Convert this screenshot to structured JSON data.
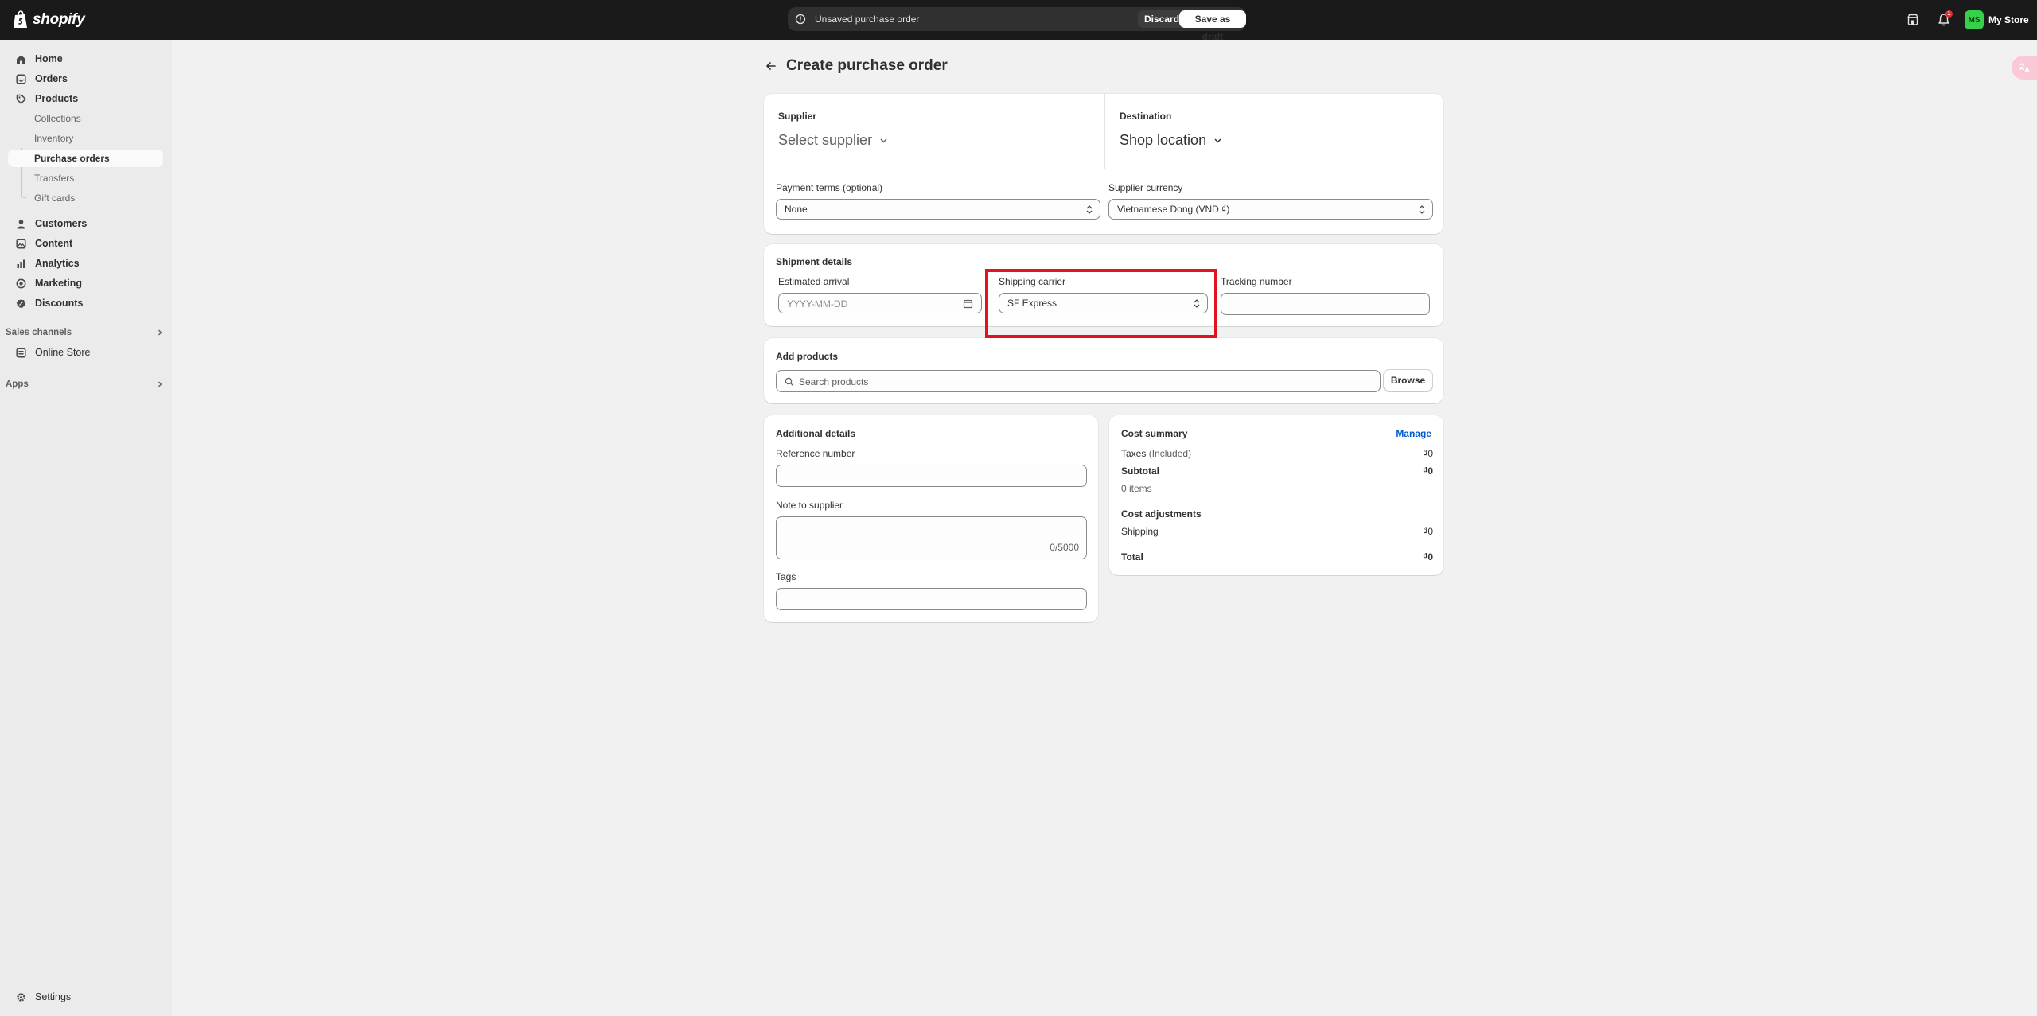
{
  "topbar": {
    "brand": "shopify",
    "save_bar": {
      "message": "Unsaved purchase order",
      "discard": "Discard",
      "save": "Save as draft"
    },
    "notification_count": "1",
    "avatar_initials": "MS",
    "store_name": "My Store"
  },
  "sidebar": {
    "items": [
      {
        "label": "Home",
        "icon": "home-icon"
      },
      {
        "label": "Orders",
        "icon": "orders-icon"
      },
      {
        "label": "Products",
        "icon": "tag-icon"
      },
      {
        "label": "Collections"
      },
      {
        "label": "Inventory"
      },
      {
        "label": "Purchase orders",
        "active": true
      },
      {
        "label": "Transfers"
      },
      {
        "label": "Gift cards"
      },
      {
        "label": "Customers",
        "icon": "person-icon"
      },
      {
        "label": "Content",
        "icon": "content-icon"
      },
      {
        "label": "Analytics",
        "icon": "analytics-icon"
      },
      {
        "label": "Marketing",
        "icon": "marketing-icon"
      },
      {
        "label": "Discounts",
        "icon": "discount-icon"
      }
    ],
    "sales_channels": {
      "label": "Sales channels",
      "items": [
        {
          "label": "Online Store",
          "icon": "store-icon"
        }
      ]
    },
    "apps": {
      "label": "Apps"
    },
    "settings": {
      "label": "Settings",
      "icon": "gear-icon"
    }
  },
  "page": {
    "title": "Create purchase order",
    "supplier": {
      "label": "Supplier",
      "value": "Select supplier"
    },
    "destination": {
      "label": "Destination",
      "value": "Shop location"
    },
    "payment_terms": {
      "label": "Payment terms (optional)",
      "value": "None"
    },
    "supplier_currency": {
      "label": "Supplier currency",
      "value": "Vietnamese Dong (VND ₫)"
    },
    "shipment": {
      "title": "Shipment details",
      "estimated_arrival": {
        "label": "Estimated arrival",
        "placeholder": "YYYY-MM-DD"
      },
      "shipping_carrier": {
        "label": "Shipping carrier",
        "value": "SF Express"
      },
      "tracking_number": {
        "label": "Tracking number",
        "value": ""
      }
    },
    "add_products": {
      "title": "Add products",
      "placeholder": "Search products",
      "browse": "Browse"
    },
    "additional": {
      "title": "Additional details",
      "reference_label": "Reference number",
      "note_label": "Note to supplier",
      "note_counter": "0/5000",
      "tags_label": "Tags"
    },
    "cost_summary": {
      "title": "Cost summary",
      "manage": "Manage",
      "taxes_label": "Taxes",
      "taxes_note": "(Included)",
      "taxes_value": "₫0",
      "subtotal_label": "Subtotal",
      "subtotal_value": "₫0",
      "items_count": "0 items",
      "adjustments_title": "Cost adjustments",
      "shipping_label": "Shipping",
      "shipping_value": "₫0",
      "total_label": "Total",
      "total_value": "₫0"
    }
  },
  "colors": {
    "topbar": "#1a1a1a",
    "highlight": "#e0141f",
    "link": "#005bd3",
    "avatar": "#36d14a"
  }
}
